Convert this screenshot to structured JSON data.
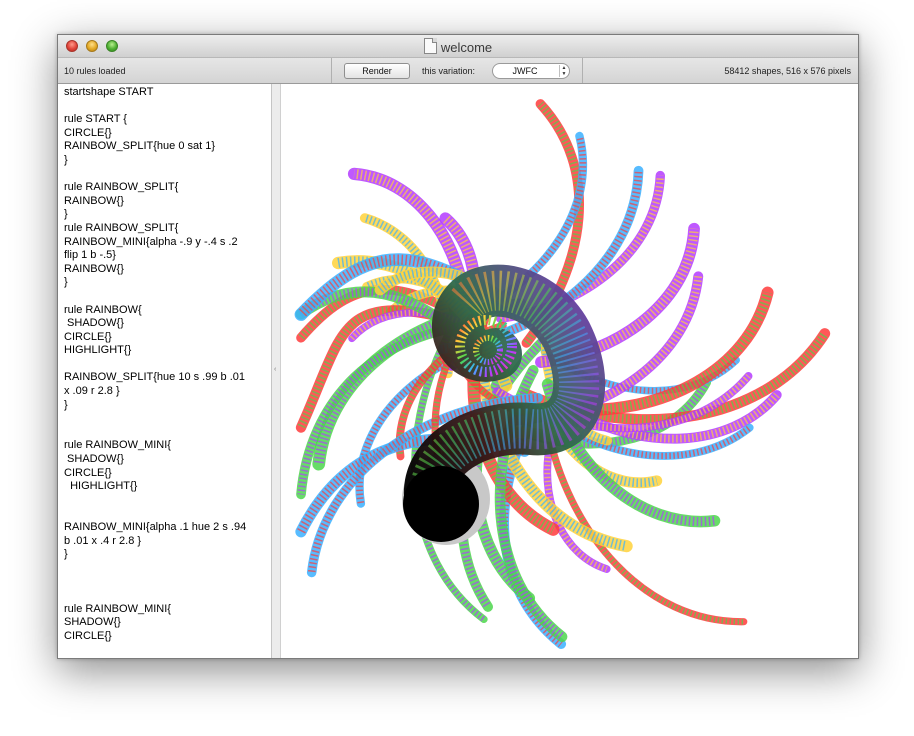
{
  "window": {
    "title": "welcome"
  },
  "toolbar": {
    "status": "10 rules loaded",
    "render_label": "Render",
    "variation_label": "this variation:",
    "variation_value": "JWFC",
    "shape_info": "58412 shapes, 516 x 576 pixels"
  },
  "editor": {
    "code": "startshape START\n\nrule START {\nCIRCLE{}\nRAINBOW_SPLIT{hue 0 sat 1}\n}\n\nrule RAINBOW_SPLIT{\nRAINBOW{}\n}\nrule RAINBOW_SPLIT{\nRAINBOW_MINI{alpha -.9 y -.4 s .2\nflip 1 b -.5}\nRAINBOW{}\n}\n\nrule RAINBOW{\n SHADOW{}\nCIRCLE{}\nHIGHLIGHT{}\n\nRAINBOW_SPLIT{hue 10 s .99 b .01\nx .09 r 2.8 }\n}\n\n\nrule RAINBOW_MINI{\n SHADOW{}\nCIRCLE{}\n  HIGHLIGHT{}\n\n\nRAINBOW_MINI{alpha .1 hue 2 s .94\nb .01 x .4 r 2.8 }\n}\n\n\n\nrule RAINBOW_MINI{\nSHADOW{}\nCIRCLE{}"
  },
  "canvas": {
    "description_colors": [
      "#ff3b3b",
      "#ffd23b",
      "#4cd64c",
      "#3bb0ff",
      "#b43bff",
      "#000000"
    ]
  }
}
